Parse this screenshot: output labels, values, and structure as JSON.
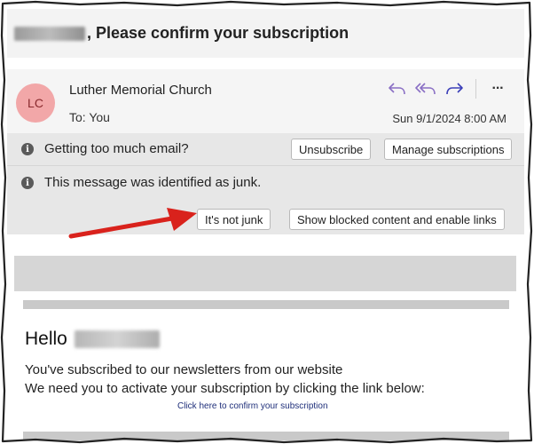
{
  "subject": {
    "text": ", Please confirm your subscription"
  },
  "message": {
    "avatar_initials": "LC",
    "sender_name": "Luther Memorial Church",
    "to_line": "To:  You",
    "date": "Sun 9/1/2024 8:00 AM",
    "actions": {
      "reply_icon": "reply-icon",
      "reply_all_icon": "reply-all-icon",
      "forward_icon": "forward-icon",
      "more_label": "···"
    }
  },
  "infobars": {
    "email_volume": {
      "text": "Getting too much email?",
      "unsubscribe_label": "Unsubscribe",
      "manage_label": "Manage subscriptions"
    },
    "junk": {
      "text": "This message was identified as junk.",
      "not_junk_label": "It's not junk",
      "show_blocked_label": "Show blocked content and enable links"
    },
    "info_icon_glyph": "i"
  },
  "body": {
    "greeting": "Hello",
    "line1": "You've subscribed to our newsletters from our website",
    "line2": "We need you to activate your subscription by clicking the link below:",
    "confirm_link": "Click here to confirm your subscription"
  },
  "colors": {
    "avatar_bg": "#f2a7a8",
    "action_icon": "#8a6fc4",
    "annotation_arrow": "#d9221c",
    "link": "#1f2f7a"
  }
}
